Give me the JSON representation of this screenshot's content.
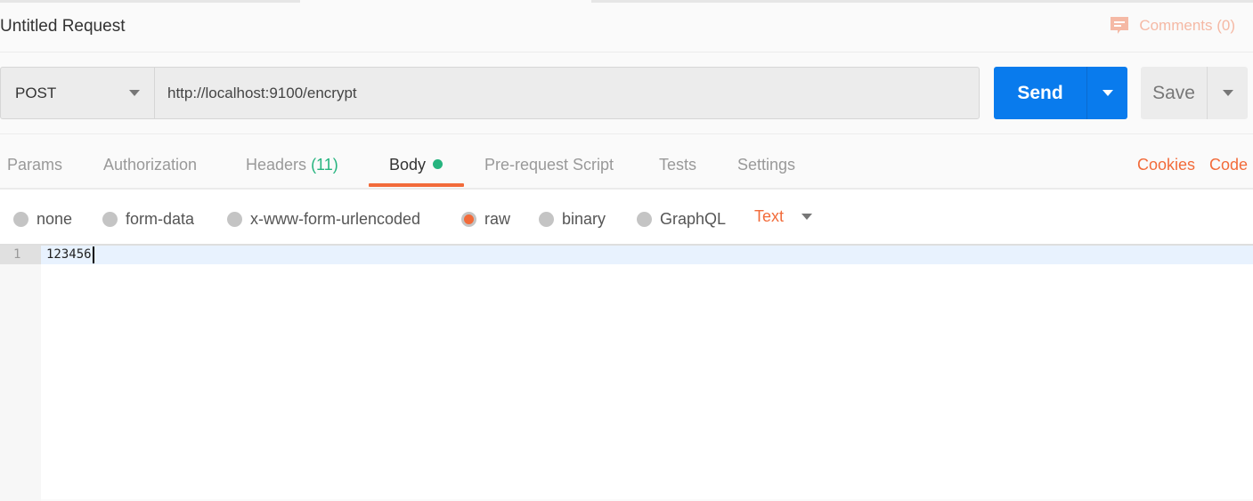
{
  "request": {
    "title": "Untitled Request",
    "comments_label": "Comments (0)",
    "method": "POST",
    "url": "http://localhost:9100/encrypt",
    "send_label": "Send",
    "save_label": "Save"
  },
  "tabs": [
    {
      "label": "Params"
    },
    {
      "label": "Authorization"
    },
    {
      "label": "Headers",
      "count": "(11)"
    },
    {
      "label": "Body",
      "active": true,
      "has_content_indicator": true
    },
    {
      "label": "Pre-request Script"
    },
    {
      "label": "Tests"
    },
    {
      "label": "Settings"
    }
  ],
  "links": {
    "cookies": "Cookies",
    "code": "Code"
  },
  "body_types": [
    {
      "label": "none",
      "selected": false
    },
    {
      "label": "form-data",
      "selected": false
    },
    {
      "label": "x-www-form-urlencoded",
      "selected": false
    },
    {
      "label": "raw",
      "selected": true
    },
    {
      "label": "binary",
      "selected": false
    },
    {
      "label": "GraphQL",
      "selected": false
    }
  ],
  "raw_format": "Text",
  "editor": {
    "lines": [
      {
        "number": "1",
        "text": "123456"
      }
    ]
  },
  "colors": {
    "accent": "#f26b3a",
    "send": "#097bed",
    "indicator": "#26b47f"
  }
}
